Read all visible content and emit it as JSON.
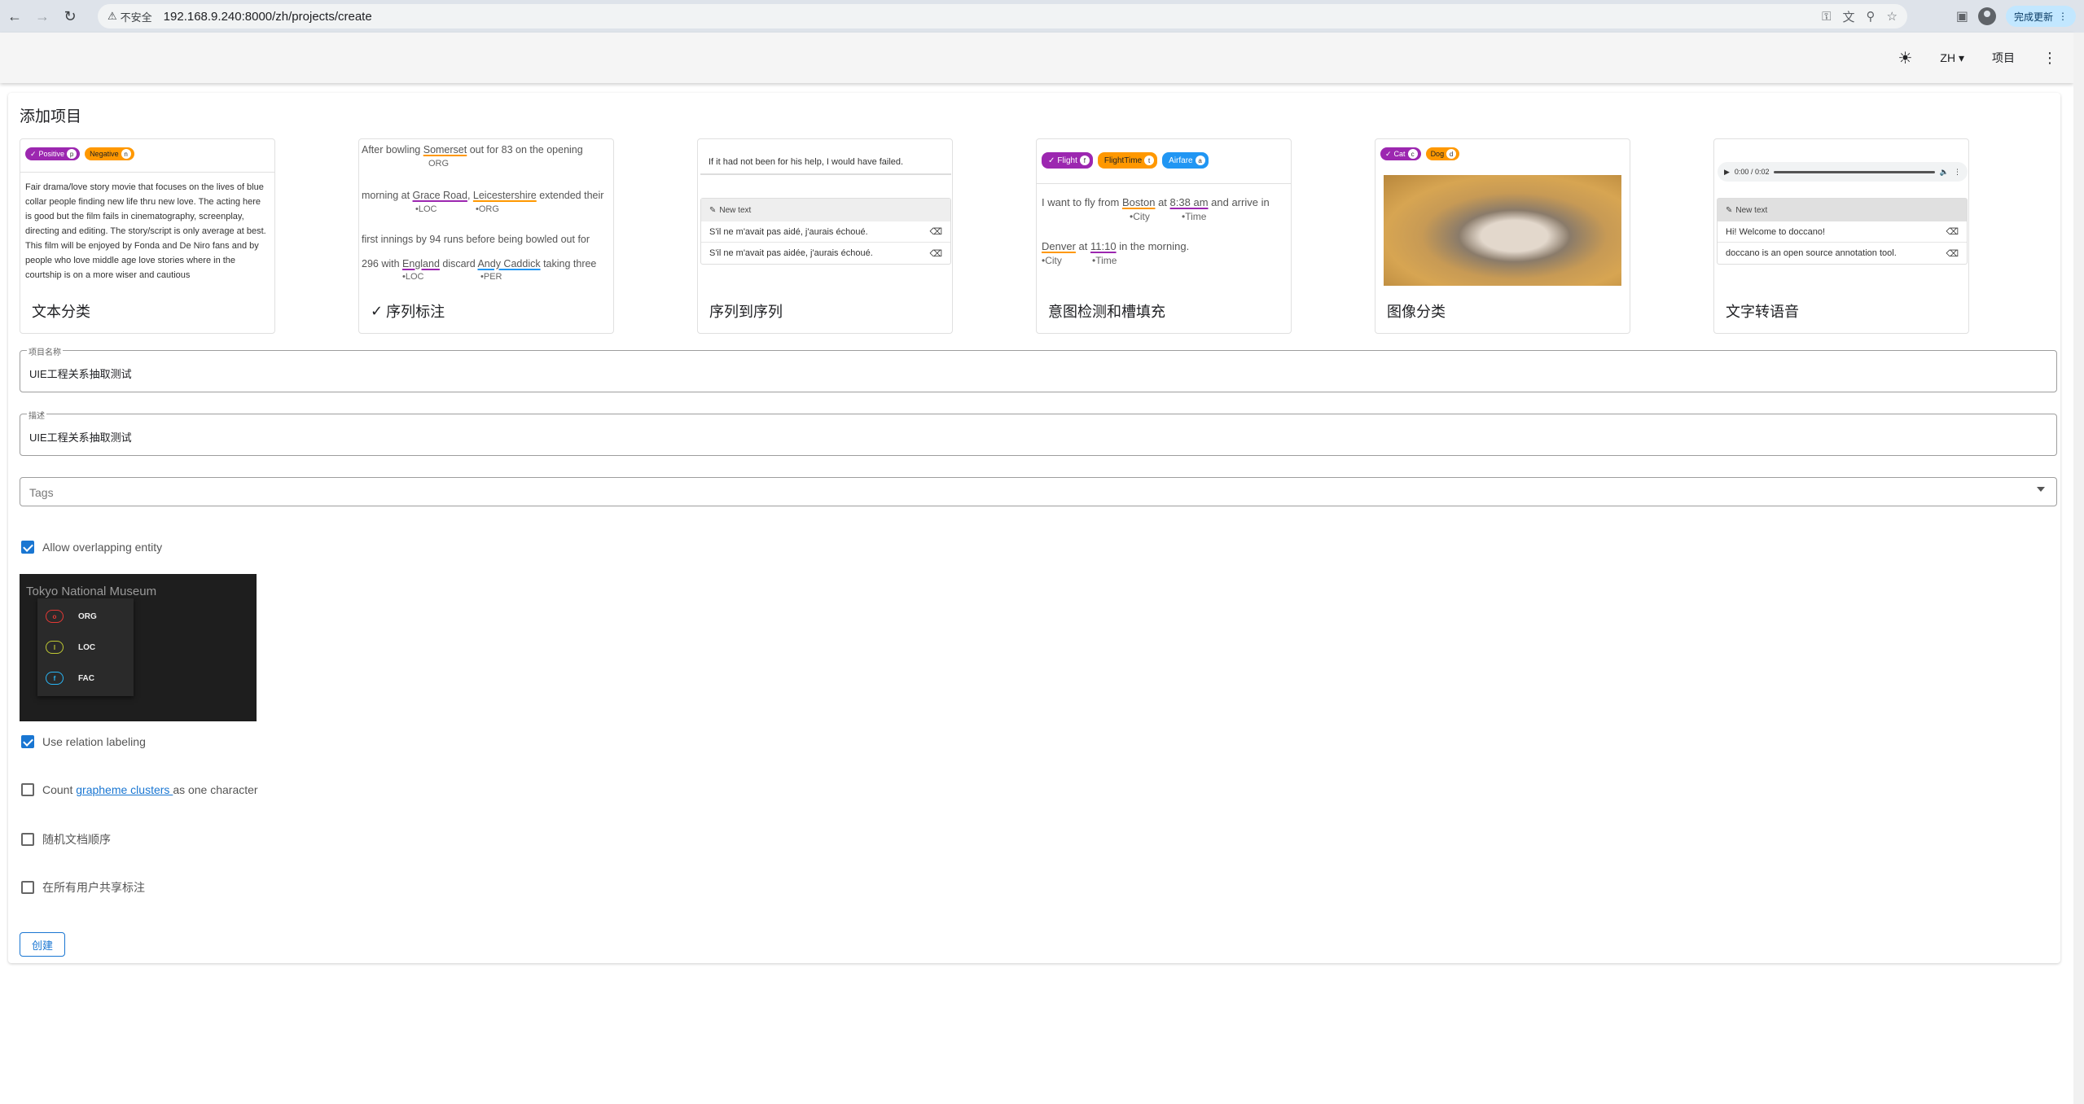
{
  "browser": {
    "insecure_label": "不安全",
    "url": "192.168.9.240:8000/zh/projects/create",
    "update_label": "完成更新"
  },
  "appbar": {
    "lang": "ZH",
    "projects": "项目"
  },
  "page": {
    "title": "添加项目"
  },
  "tiles": {
    "text_classification": {
      "label": "文本分类",
      "chips": [
        {
          "text": "Positive",
          "key": "p",
          "color": "#9c27b0"
        },
        {
          "text": "Negative",
          "key": "n",
          "color": "#ff9800"
        }
      ],
      "body": "Fair drama/love story movie that focuses on the lives of blue collar people finding new life thru new love. The acting here is good but the film fails in cinematography, screenplay, directing and editing. The story/script is only average at best. This film will be enjoyed by Fonda and De Niro fans and by people who love middle age love stories where in the courtship is on a more wiser and cautious"
    },
    "sequence_labeling": {
      "label": "序列标注",
      "line1a": "After bowling ",
      "line1b": "Somerset",
      "line1c": " out for 83 on the opening",
      "tag1": "ORG",
      "line2a": "morning at ",
      "line2b": "Grace Road",
      "line2c": ", ",
      "line2d": "Leicestershire",
      "line2e": " extended their",
      "tag2a": "LOC",
      "tag2b": "ORG",
      "line3": "first innings by 94 runs before being bowled out for",
      "line4a": "296 with ",
      "line4b": "England",
      "line4c": " discard ",
      "line4d": "Andy Caddick",
      "line4e": " taking three",
      "tag4a": "LOC",
      "tag4b": "PER"
    },
    "seq2seq": {
      "label": "序列到序列",
      "source": "If it had not been for his help, I would have failed.",
      "new_text": "New text",
      "out1": "S'il ne m'avait pas aidé, j'aurais échoué.",
      "out2": "S'il ne m'avait pas aidée, j'aurais échoué."
    },
    "intent": {
      "label": "意图检测和槽填充",
      "chips": [
        {
          "text": "Flight",
          "key": "f",
          "color": "#9c27b0"
        },
        {
          "text": "FlightTime",
          "key": "t",
          "color": "#ff9800"
        },
        {
          "text": "Airfare",
          "key": "a",
          "color": "#2196f3"
        }
      ],
      "l1a": "I want to fly from ",
      "l1b": "Boston",
      "l1c": " at ",
      "l1d": "8:38 am",
      "l1e": " and arrive in",
      "t1a": "City",
      "t1b": "Time",
      "l2a": "Denver",
      "l2b": " at ",
      "l2c": "11:10",
      "l2d": " in the morning.",
      "t2a": "City",
      "t2b": "Time"
    },
    "image": {
      "label": "图像分类",
      "chips": [
        {
          "text": "Cat",
          "key": "c",
          "color": "#9c27b0"
        },
        {
          "text": "Dog",
          "key": "d",
          "color": "#ff9800"
        }
      ]
    },
    "speech": {
      "label": "文字转语音",
      "time": "0:00 / 0:02",
      "new_text": "New text",
      "out1": "Hi! Welcome to doccano!",
      "out2": "doccano is an open source annotation tool."
    }
  },
  "form": {
    "name_label": "项目名称",
    "name_value": "UIE工程关系抽取测试",
    "desc_label": "描述",
    "desc_value": "UIE工程关系抽取测试",
    "tags_placeholder": "Tags",
    "allow_overlap": "Allow overlapping entity",
    "use_relation": "Use relation labeling",
    "grapheme_prefix": "Count ",
    "grapheme_link": "grapheme clusters ",
    "grapheme_suffix": "as one character",
    "random_order": "随机文档顺序",
    "share_annotations": "在所有用户共享标注",
    "create": "创建"
  },
  "demo": {
    "title": "Tokyo National Museum",
    "items": [
      {
        "label": "ORG",
        "key": "o",
        "color": "#e53935"
      },
      {
        "label": "LOC",
        "key": "l",
        "color": "#c0ca33"
      },
      {
        "label": "FAC",
        "key": "f",
        "color": "#29b6f6"
      }
    ]
  }
}
